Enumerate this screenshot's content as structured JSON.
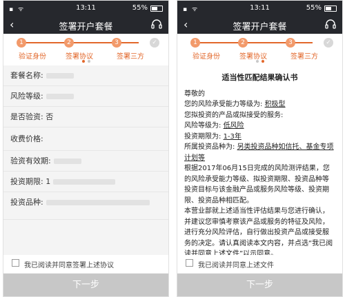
{
  "status_bar": {
    "time": "13:11",
    "battery": "55%"
  },
  "nav": {
    "title": "签署开户套餐"
  },
  "steps": [
    {
      "num": "1",
      "label": "验证身份"
    },
    {
      "num": "2",
      "label": "签署协议"
    },
    {
      "num": "3",
      "label": "签署三方"
    }
  ],
  "form": {
    "package_label": "套餐名称:",
    "risk_label": "风险等级:",
    "has_exp_label": "是否验资:",
    "has_exp_value": "否",
    "fee_label": "收费价格:",
    "validity_label": "验资有效期:",
    "period_label": "投资期限:",
    "period_value": "1",
    "variety_label": "投资品种:"
  },
  "agree_left": "我已阅读并同意签署上述协议",
  "agree_right": "我已阅读并同意上述文件",
  "next_button": "下一步",
  "doc": {
    "title": "适当性匹配结果确认书",
    "greeting": "尊敬的",
    "l1": "您的风险承受能力等级为:",
    "l1v": "积极型",
    "l2": "您拟投资的产品或拟接受的服务:",
    "l3": "风险等级为:",
    "l3v": "低风险",
    "l4": "投资期限为:",
    "l4v": "1-3年",
    "l5": "所属投资品种为:",
    "l5v": "另类投资品种如信托、基金专项计划等",
    "p1": "根据2017年06月15日完成的风险测评结果，您的风险承受能力等级、拟投资期限、投资品种等投资目标与该金融产品或服务风险等级、投资期限、投资品种相匹配。",
    "p2": "本营业部就上述适当性评估结果与您进行确认，并建议您审慎考察该产品或服务的特征及风险，进行充分风险评估，自行做出投资产品或接受服务的决定。请认真阅读本文内容，并点选“我已阅读并同意上述文件”以示同意。"
  }
}
